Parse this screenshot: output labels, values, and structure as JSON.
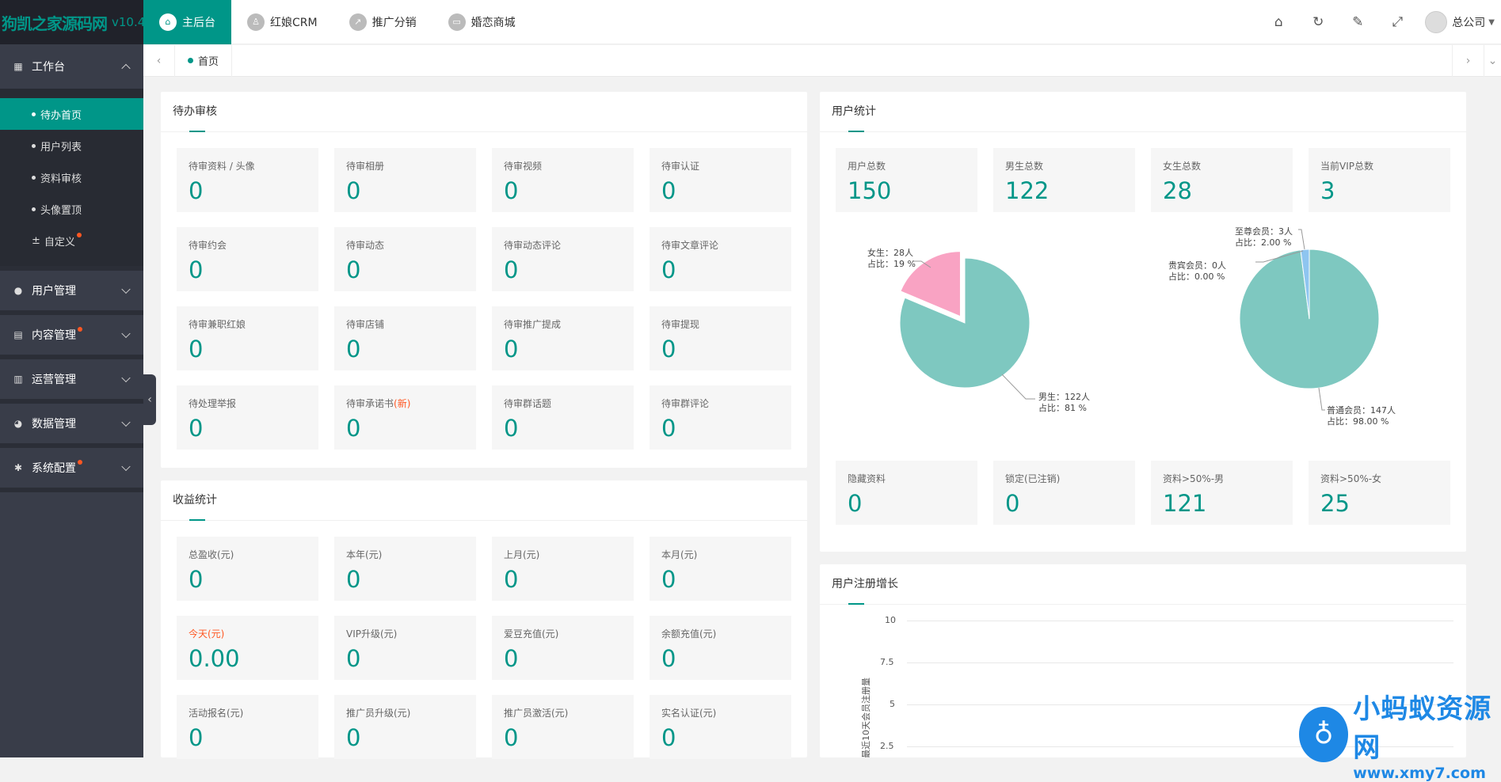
{
  "app": {
    "name": "狗凯之家源码网",
    "version": "v10.4"
  },
  "sidebar": {
    "workbench": {
      "label": "工作台",
      "items": [
        {
          "label": "待办首页"
        },
        {
          "label": "用户列表"
        },
        {
          "label": "资料审核"
        },
        {
          "label": "头像置顶"
        },
        {
          "label": "自定义"
        }
      ]
    },
    "groups": [
      {
        "label": "用户管理"
      },
      {
        "label": "内容管理"
      },
      {
        "label": "运营管理"
      },
      {
        "label": "数据管理"
      },
      {
        "label": "系统配置"
      }
    ]
  },
  "topbar": {
    "tabs": [
      {
        "label": "主后台"
      },
      {
        "label": "红娘CRM"
      },
      {
        "label": "推广分销"
      },
      {
        "label": "婚恋商城"
      }
    ],
    "user": "总公司"
  },
  "pagetabs": {
    "home": "首页"
  },
  "pending": {
    "title": "待办审核",
    "items": [
      {
        "label": "待审资料 / 头像",
        "value": "0"
      },
      {
        "label": "待审相册",
        "value": "0"
      },
      {
        "label": "待审视频",
        "value": "0"
      },
      {
        "label": "待审认证",
        "value": "0"
      },
      {
        "label": "待审约会",
        "value": "0"
      },
      {
        "label": "待审动态",
        "value": "0"
      },
      {
        "label": "待审动态评论",
        "value": "0"
      },
      {
        "label": "待审文章评论",
        "value": "0"
      },
      {
        "label": "待审兼职红娘",
        "value": "0"
      },
      {
        "label": "待审店铺",
        "value": "0"
      },
      {
        "label": "待审推广提成",
        "value": "0"
      },
      {
        "label": "待审提现",
        "value": "0"
      },
      {
        "label": "待处理举报",
        "value": "0"
      },
      {
        "label": "待审承诺书",
        "label_new": "(新)",
        "value": "0"
      },
      {
        "label": "待审群话题",
        "value": "0"
      },
      {
        "label": "待审群评论",
        "value": "0"
      }
    ]
  },
  "income": {
    "title": "收益统计",
    "items": [
      {
        "label": "总盈收(元)",
        "value": "0"
      },
      {
        "label": "本年(元)",
        "value": "0"
      },
      {
        "label": "上月(元)",
        "value": "0"
      },
      {
        "label": "本月(元)",
        "value": "0"
      },
      {
        "label": "今天(元)",
        "value": "0.00"
      },
      {
        "label": "VIP升级(元)",
        "value": "0"
      },
      {
        "label": "爱豆充值(元)",
        "value": "0"
      },
      {
        "label": "余额充值(元)",
        "value": "0"
      },
      {
        "label": "活动报名(元)",
        "value": "0"
      },
      {
        "label": "推广员升级(元)",
        "value": "0"
      },
      {
        "label": "推广员激活(元)",
        "value": "0"
      },
      {
        "label": "实名认证(元)",
        "value": "0"
      }
    ]
  },
  "users": {
    "title": "用户统计",
    "top": [
      {
        "label": "用户总数",
        "value": "150"
      },
      {
        "label": "男生总数",
        "value": "122"
      },
      {
        "label": "女生总数",
        "value": "28"
      },
      {
        "label": "当前VIP总数",
        "value": "3"
      }
    ],
    "bottom": [
      {
        "label": "隐藏资料",
        "value": "0"
      },
      {
        "label": "锁定(已注销)",
        "value": "0"
      },
      {
        "label": "资料>50%-男",
        "value": "121"
      },
      {
        "label": "资料>50%-女",
        "value": "25"
      }
    ],
    "gender_pie": {
      "female_l1": "女生：28人",
      "female_l2": "占比：19 %",
      "male_l1": "男生：122人",
      "male_l2": "占比：81 %",
      "colors": {
        "male": "#7ec8c0",
        "female": "#f9a3c3"
      }
    },
    "member_pie": {
      "supreme_l1": "至尊会员：3人",
      "supreme_l2": "占比：2.00 %",
      "vip_l1": "贵宾会员：0人",
      "vip_l2": "占比：0.00 %",
      "normal_l1": "普通会员：147人",
      "normal_l2": "占比：98.00 %",
      "colors": {
        "normal": "#7ec8c0",
        "supreme": "#8ec5f0",
        "vip": "#f9a3c3"
      }
    }
  },
  "growth": {
    "title": "用户注册增长",
    "ylabel": "最近10天会员注册量",
    "yticks": [
      "10",
      "7.5",
      "5",
      "2.5"
    ]
  },
  "chart_data": [
    {
      "type": "pie",
      "categories": [
        "男生",
        "女生"
      ],
      "values": [
        122,
        28
      ]
    },
    {
      "type": "pie",
      "categories": [
        "普通会员",
        "贵宾会员",
        "至尊会员"
      ],
      "values": [
        147,
        0,
        3
      ]
    },
    {
      "type": "line",
      "title": "用户注册增长",
      "ylabel": "最近10天会员注册量",
      "ylim": [
        0,
        10
      ],
      "yticks": [
        2.5,
        5,
        7.5,
        10
      ]
    }
  ],
  "watermark": {
    "t1": "小蚂蚁资源网",
    "t2": "www.xmy7.com"
  },
  "colors": {
    "accent": "#009688",
    "sidebar": "#393d49",
    "badge": "#ff5722"
  }
}
